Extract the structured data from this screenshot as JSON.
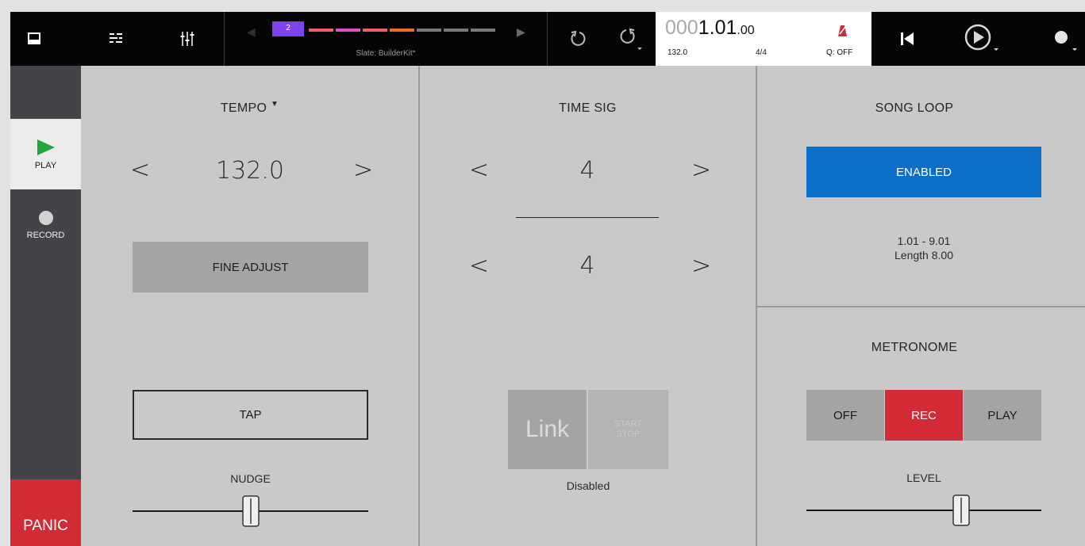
{
  "topbar": {
    "icons": {
      "browser": "drawer-icon",
      "list": "list-icon",
      "mixer": "mixer-icon",
      "undo": "undo-icon",
      "redo": "redo-icon",
      "metronome": "metronome-icon",
      "rewind": "skip-back-icon",
      "play": "play-icon",
      "record": "record-icon"
    },
    "slate": {
      "pad_number": "2",
      "name": "Slate: BuilderKit*",
      "segment_colors": [
        "#f25d6a",
        "#e04fc5",
        "#f25d6a",
        "#ee6b1e",
        "#7a7a7a",
        "#7a7a7a",
        "#7a7a7a"
      ]
    },
    "counter": {
      "dim_part": "000",
      "main_part": "1.01",
      "sub_part": ".00",
      "tempo": "132.0",
      "time_sig": "4/4"
    },
    "quantize": "Q: OFF"
  },
  "sidebar": {
    "play_label": "PLAY",
    "record_label": "RECORD",
    "panic_label": "PANIC"
  },
  "tempo": {
    "title": "TEMPO",
    "value": "132.0",
    "prev": "<",
    "next": ">",
    "fine_adjust_label": "FINE ADJUST",
    "tap_label": "TAP",
    "nudge_label": "NUDGE",
    "nudge_position": 0.5
  },
  "time_sig": {
    "title": "TIME SIG",
    "numerator": "4",
    "denominator": "4",
    "prev": "<",
    "next": ">",
    "link_label": "Link",
    "start_stop_label": "START STOP",
    "link_status": "Disabled"
  },
  "song_loop": {
    "title": "SONG LOOP",
    "enabled_label": "ENABLED",
    "range": "1.01 - 9.01",
    "length": "Length 8.00"
  },
  "metronome": {
    "title": "METRONOME",
    "options": [
      "OFF",
      "REC",
      "PLAY"
    ],
    "selected": "REC",
    "level_label": "LEVEL",
    "level_position": 0.66
  },
  "colors": {
    "accent_blue": "#0a6fc8",
    "accent_red": "#d22b35",
    "play_green": "#1fa63d"
  }
}
